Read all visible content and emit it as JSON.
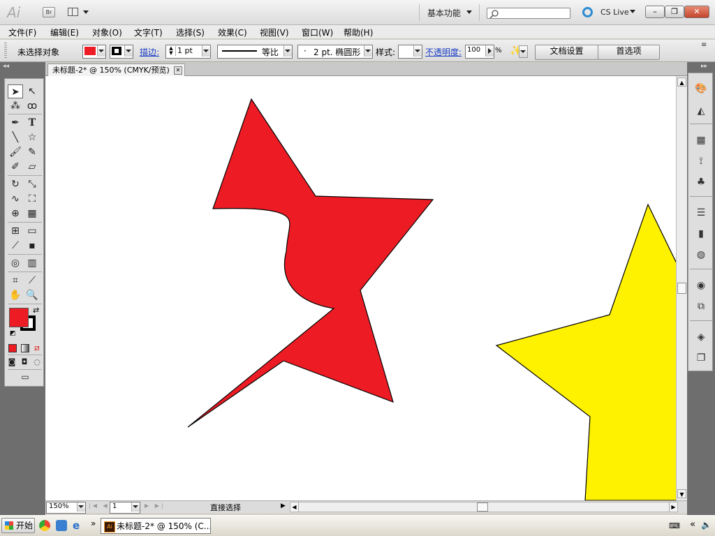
{
  "app": {
    "logo": "Ai",
    "bridge": "Br",
    "workspace": "基本功能",
    "cslive": "CS Live"
  },
  "window_controls": {
    "minimize": "–",
    "restore": "❐",
    "close": "✕"
  },
  "menu": [
    "文件(F)",
    "编辑(E)",
    "对象(O)",
    "文字(T)",
    "选择(S)",
    "效果(C)",
    "视图(V)",
    "窗口(W)",
    "帮助(H)"
  ],
  "control_bar": {
    "selection_status": "未选择对象",
    "fill_color": "#ed1c24",
    "stroke_label": "描边:",
    "stroke_weight": "1 pt",
    "stroke_profile": "等比",
    "brush": "2 pt. 椭圆形",
    "style_label": "样式:",
    "opacity_label": "不透明度:",
    "opacity_value": "100",
    "opacity_unit": "%",
    "doc_settings_button": "文档设置",
    "preferences_button": "首选项"
  },
  "document": {
    "tab_title": "未标题-2* @ 150% (CMYK/预览)"
  },
  "colors": {
    "fill": "#ed1c24",
    "stroke": "#000000",
    "red_shape": "#ed1c24",
    "yellow_star": "#fff200"
  },
  "status_bar": {
    "zoom": "150%",
    "artboard": "1",
    "tool_status": "直接选择"
  },
  "taskbar": {
    "start": "开始",
    "task": "未标题-2* @ 150% (C..."
  }
}
